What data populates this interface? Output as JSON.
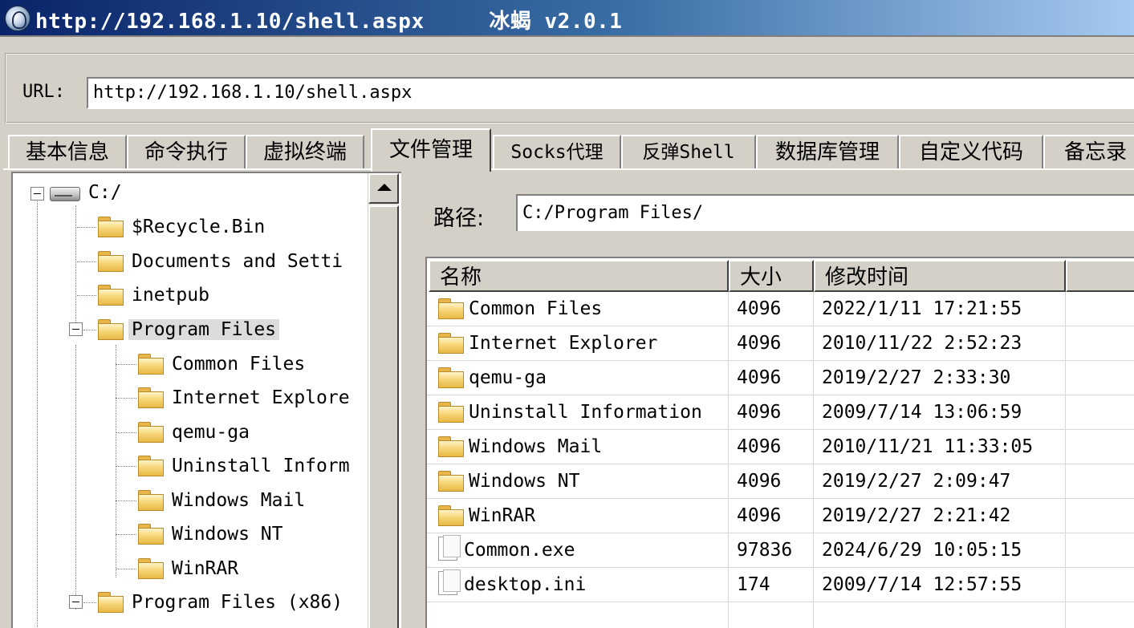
{
  "window": {
    "title": "http://192.168.1.10/shell.aspx     冰蝎 v2.0.1"
  },
  "url_bar": {
    "label": "URL:",
    "value": "http://192.168.1.10/shell.aspx"
  },
  "tabs": [
    {
      "label": "基本信息",
      "active": false
    },
    {
      "label": "命令执行",
      "active": false
    },
    {
      "label": "虚拟终端",
      "active": false
    },
    {
      "label": "文件管理",
      "active": true
    },
    {
      "label": "Socks代理",
      "active": false
    },
    {
      "label": "反弹Shell",
      "active": false
    },
    {
      "label": "数据库管理",
      "active": false
    },
    {
      "label": "自定义代码",
      "active": false
    },
    {
      "label": "备忘录",
      "active": false
    }
  ],
  "tree": {
    "root": "C:/",
    "items": [
      {
        "label": "$Recycle.Bin"
      },
      {
        "label": "Documents and Setti"
      },
      {
        "label": "inetpub"
      },
      {
        "label": "Program Files",
        "selected": true,
        "expanded": true
      },
      {
        "label": "Common Files"
      },
      {
        "label": "Internet Explore"
      },
      {
        "label": "qemu-ga"
      },
      {
        "label": "Uninstall Inform"
      },
      {
        "label": "Windows Mail"
      },
      {
        "label": "Windows NT"
      },
      {
        "label": "WinRAR"
      },
      {
        "label": "Program Files (x86)",
        "expanded": true
      }
    ]
  },
  "path": {
    "label": "路径:",
    "value": "C:/Program Files/"
  },
  "file_table": {
    "headers": [
      "名称",
      "大小",
      "修改时间"
    ],
    "rows": [
      {
        "name": "Common Files",
        "size": "4096",
        "modified": "2022/1/11 17:21:55",
        "type": "folder"
      },
      {
        "name": "Internet Explorer",
        "size": "4096",
        "modified": "2010/11/22 2:52:23",
        "type": "folder"
      },
      {
        "name": "qemu-ga",
        "size": "4096",
        "modified": "2019/2/27 2:33:30",
        "type": "folder"
      },
      {
        "name": "Uninstall Information",
        "size": "4096",
        "modified": "2009/7/14 13:06:59",
        "type": "folder"
      },
      {
        "name": "Windows Mail",
        "size": "4096",
        "modified": "2010/11/21 11:33:05",
        "type": "folder"
      },
      {
        "name": "Windows NT",
        "size": "4096",
        "modified": "2019/2/27 2:09:47",
        "type": "folder"
      },
      {
        "name": "WinRAR",
        "size": "4096",
        "modified": "2019/2/27 2:21:42",
        "type": "folder"
      },
      {
        "name": "Common.exe",
        "size": "97836",
        "modified": "2024/6/29 10:05:15",
        "type": "file"
      },
      {
        "name": "desktop.ini",
        "size": "174",
        "modified": "2009/7/14 12:57:55",
        "type": "file"
      }
    ]
  }
}
